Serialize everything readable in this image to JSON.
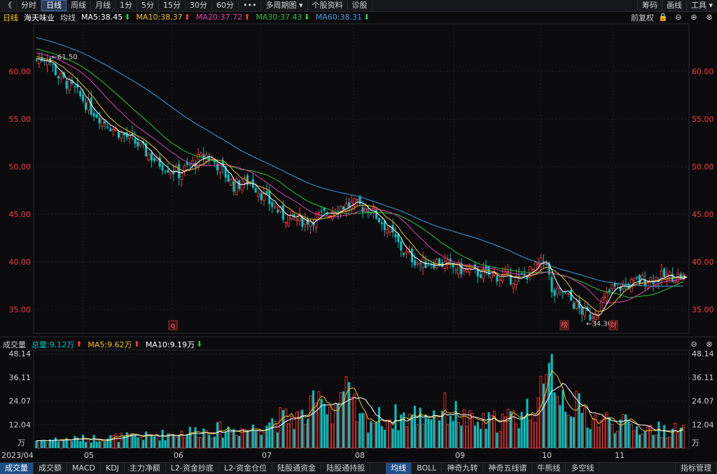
{
  "topbar": {
    "back": "《",
    "buttons": [
      "分时",
      "日线",
      "周线",
      "月线",
      "1分",
      "5分",
      "15分",
      "30分",
      "60分",
      "•••",
      "多周期图 ▾",
      "个股资料",
      "诊股"
    ],
    "active_index": 1,
    "right_buttons": [
      "筹码",
      "画线",
      "工具 ▾"
    ]
  },
  "info": {
    "period": "日线",
    "name": "海天味业",
    "ma_label": "均线",
    "ma5": "MA5:38.45",
    "ma10": "MA10:38.37",
    "ma20": "MA20:37.72",
    "ma30": "MA30:37.43",
    "ma60": "MA60:38.31",
    "adjust": "前复权"
  },
  "volume_info": {
    "label": "成交量",
    "total": "总量:9.12万",
    "ma5": "MA5:9.62万",
    "ma10": "MA10:9.19万"
  },
  "price_axis": {
    "ticks": [
      "60.00",
      "55.00",
      "50.00",
      "45.00",
      "40.00",
      "35.00"
    ],
    "values": [
      60,
      55,
      50,
      45,
      40,
      35
    ]
  },
  "volume_axis": {
    "ticks": [
      "48.14",
      "36.11",
      "24.07",
      "12.04"
    ],
    "values": [
      48.14,
      36.11,
      24.07,
      12.04
    ],
    "unit": "万"
  },
  "x_axis": {
    "labels": [
      "2023/04",
      "05",
      "06",
      "07",
      "08",
      "09",
      "10",
      "11"
    ]
  },
  "annotations": {
    "high": "61.50",
    "low": "34.30",
    "marks": [
      "q",
      "榜",
      "财"
    ]
  },
  "colors": {
    "up": "#ff3b3b",
    "down": "#00c5c5",
    "ma5": "#ffffff",
    "ma10": "#f0c020",
    "ma20": "#e040b0",
    "ma30": "#30c040",
    "ma60": "#3a9be8"
  },
  "chart_data": {
    "type": "candlestick",
    "ylim": [
      32.5,
      65
    ],
    "volume_ylim": [
      0,
      50
    ],
    "ma_last": {
      "MA5": 38.45,
      "MA10": 38.37,
      "MA20": 37.72,
      "MA30": 37.43,
      "MA60": 38.31
    },
    "price_keypoints": [
      [
        0,
        61.2
      ],
      [
        4,
        61.5
      ],
      [
        8,
        59.5
      ],
      [
        14,
        58.0
      ],
      [
        20,
        56.0
      ],
      [
        28,
        54.0
      ],
      [
        36,
        52.5
      ],
      [
        44,
        50.5
      ],
      [
        52,
        49.3
      ],
      [
        58,
        50.5
      ],
      [
        62,
        51.2
      ],
      [
        66,
        50.2
      ],
      [
        72,
        48.0
      ],
      [
        78,
        48.5
      ],
      [
        84,
        46.5
      ],
      [
        90,
        44.8
      ],
      [
        98,
        44.3
      ],
      [
        104,
        44.8
      ],
      [
        110,
        45.8
      ],
      [
        116,
        46.0
      ],
      [
        122,
        45.5
      ],
      [
        128,
        43.5
      ],
      [
        134,
        41.0
      ],
      [
        140,
        39.8
      ],
      [
        146,
        40.0
      ],
      [
        152,
        39.4
      ],
      [
        158,
        39.0
      ],
      [
        164,
        38.7
      ],
      [
        170,
        38.4
      ],
      [
        176,
        38.2
      ],
      [
        182,
        39.3
      ],
      [
        186,
        40.3
      ],
      [
        188,
        36.5
      ],
      [
        192,
        36.8
      ],
      [
        198,
        35.0
      ],
      [
        202,
        34.3
      ],
      [
        206,
        35.5
      ],
      [
        210,
        37.2
      ],
      [
        214,
        37.4
      ],
      [
        220,
        38.0
      ],
      [
        226,
        38.3
      ],
      [
        232,
        38.5
      ],
      [
        236,
        38.4
      ]
    ],
    "volume_keypoints": [
      [
        0,
        4
      ],
      [
        20,
        5
      ],
      [
        40,
        6
      ],
      [
        60,
        9
      ],
      [
        80,
        10
      ],
      [
        84,
        14
      ],
      [
        98,
        16
      ],
      [
        104,
        25
      ],
      [
        108,
        20
      ],
      [
        112,
        30
      ],
      [
        118,
        14
      ],
      [
        140,
        17
      ],
      [
        150,
        20
      ],
      [
        160,
        12
      ],
      [
        176,
        16
      ],
      [
        186,
        28
      ],
      [
        188,
        48
      ],
      [
        190,
        30
      ],
      [
        196,
        22
      ],
      [
        202,
        15
      ],
      [
        210,
        14
      ],
      [
        220,
        10
      ],
      [
        236,
        9
      ]
    ]
  },
  "bottombar": {
    "tabs": [
      "成交量",
      "成交额",
      "MACD",
      "KDJ",
      "主力净额",
      "L2-资金抄底",
      "L2-资金仓位",
      "陆股通资金",
      "陆股通持股",
      "均线",
      "BOLL",
      "神奇九转",
      "神奇五线谱",
      "牛熊线",
      "多空线"
    ],
    "active_index": 0,
    "active2_index": 9,
    "more": "指标管理"
  }
}
